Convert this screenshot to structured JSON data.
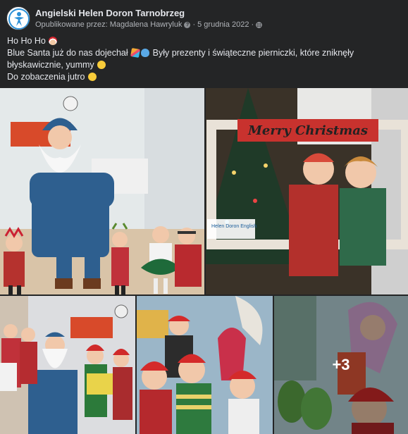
{
  "post": {
    "page_name": "Angielski Helen Doron Tarnobrzeg",
    "published_by_label": "Opublikowane przez:",
    "author": "Magdalena Hawryluk",
    "date": "5 grudnia 2022",
    "separator": "·",
    "text_lines": [
      "Ho Ho Ho",
      "Blue Santa już do nas dojechał",
      "Były prezenty i świąteczne pierniczki, które zniknęły błyskawicznie, yummy",
      "Do zobaczenia jutro"
    ],
    "emojis": [
      "santa-emoji",
      "party-popper-emoji",
      "blue-heart-emoji",
      "smile-emoji"
    ]
  },
  "photos": {
    "photo2_sign": "Merry Christmas",
    "photo2_frame_label": "Helen Doron English",
    "more_count": "+3"
  },
  "colors": {
    "background": "#242526",
    "text": "#e4e6eb",
    "secondary_text": "#b0b3b8",
    "santa_blue": "#2e5f8f"
  }
}
